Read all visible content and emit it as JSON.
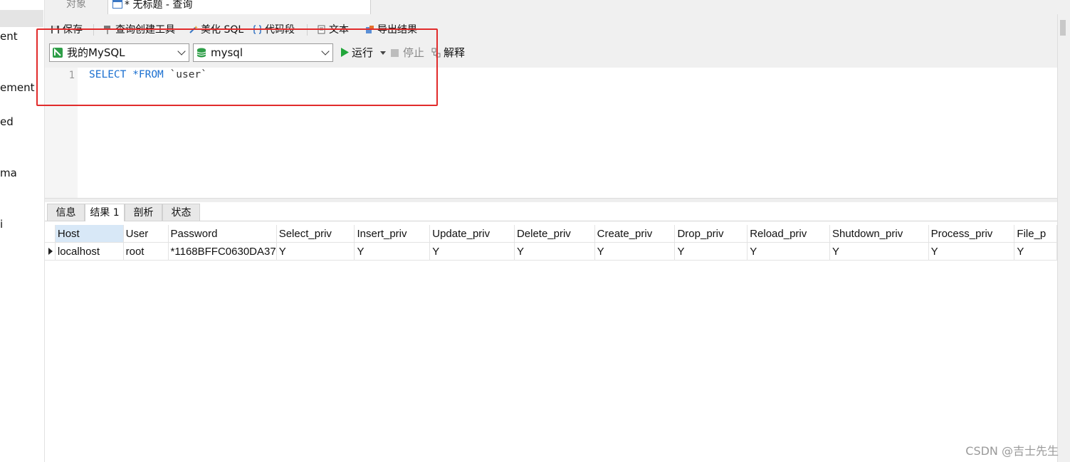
{
  "left_panel": {
    "items": [
      "ent",
      "ement",
      "ed",
      "ma",
      "i"
    ]
  },
  "tabs": {
    "objects": "对象",
    "query": "* 无标题 - 查询"
  },
  "toolbar": {
    "save": "保存",
    "query_builder": "查询创建工具",
    "beautify_sql": "美化 SQL",
    "code_snippet": "代码段",
    "text": "文本",
    "export_results": "导出结果",
    "connection": "我的MySQL",
    "database": "mysql",
    "run": "运行",
    "stop": "停止",
    "explain": "解释"
  },
  "editor": {
    "line_number": "1",
    "keyword_select": "SELECT",
    "keyword_from": "*FROM",
    "table": "`user`"
  },
  "result_tabs": [
    "信息",
    "结果 1",
    "剖析",
    "状态"
  ],
  "grid": {
    "columns": [
      "Host",
      "User",
      "Password",
      "Select_priv",
      "Insert_priv",
      "Update_priv",
      "Delete_priv",
      "Create_priv",
      "Drop_priv",
      "Reload_priv",
      "Shutdown_priv",
      "Process_priv",
      "File_p"
    ],
    "rows": [
      [
        "localhost",
        "root",
        "*1168BFFC0630DA37",
        "Y",
        "Y",
        "Y",
        "Y",
        "Y",
        "Y",
        "Y",
        "Y",
        "Y",
        "Y"
      ]
    ]
  },
  "watermark": "CSDN @吉士先生",
  "colors": {
    "highlight": "#e12b2b",
    "keyword": "#1a6fd0",
    "run_green": "#22a63a"
  }
}
